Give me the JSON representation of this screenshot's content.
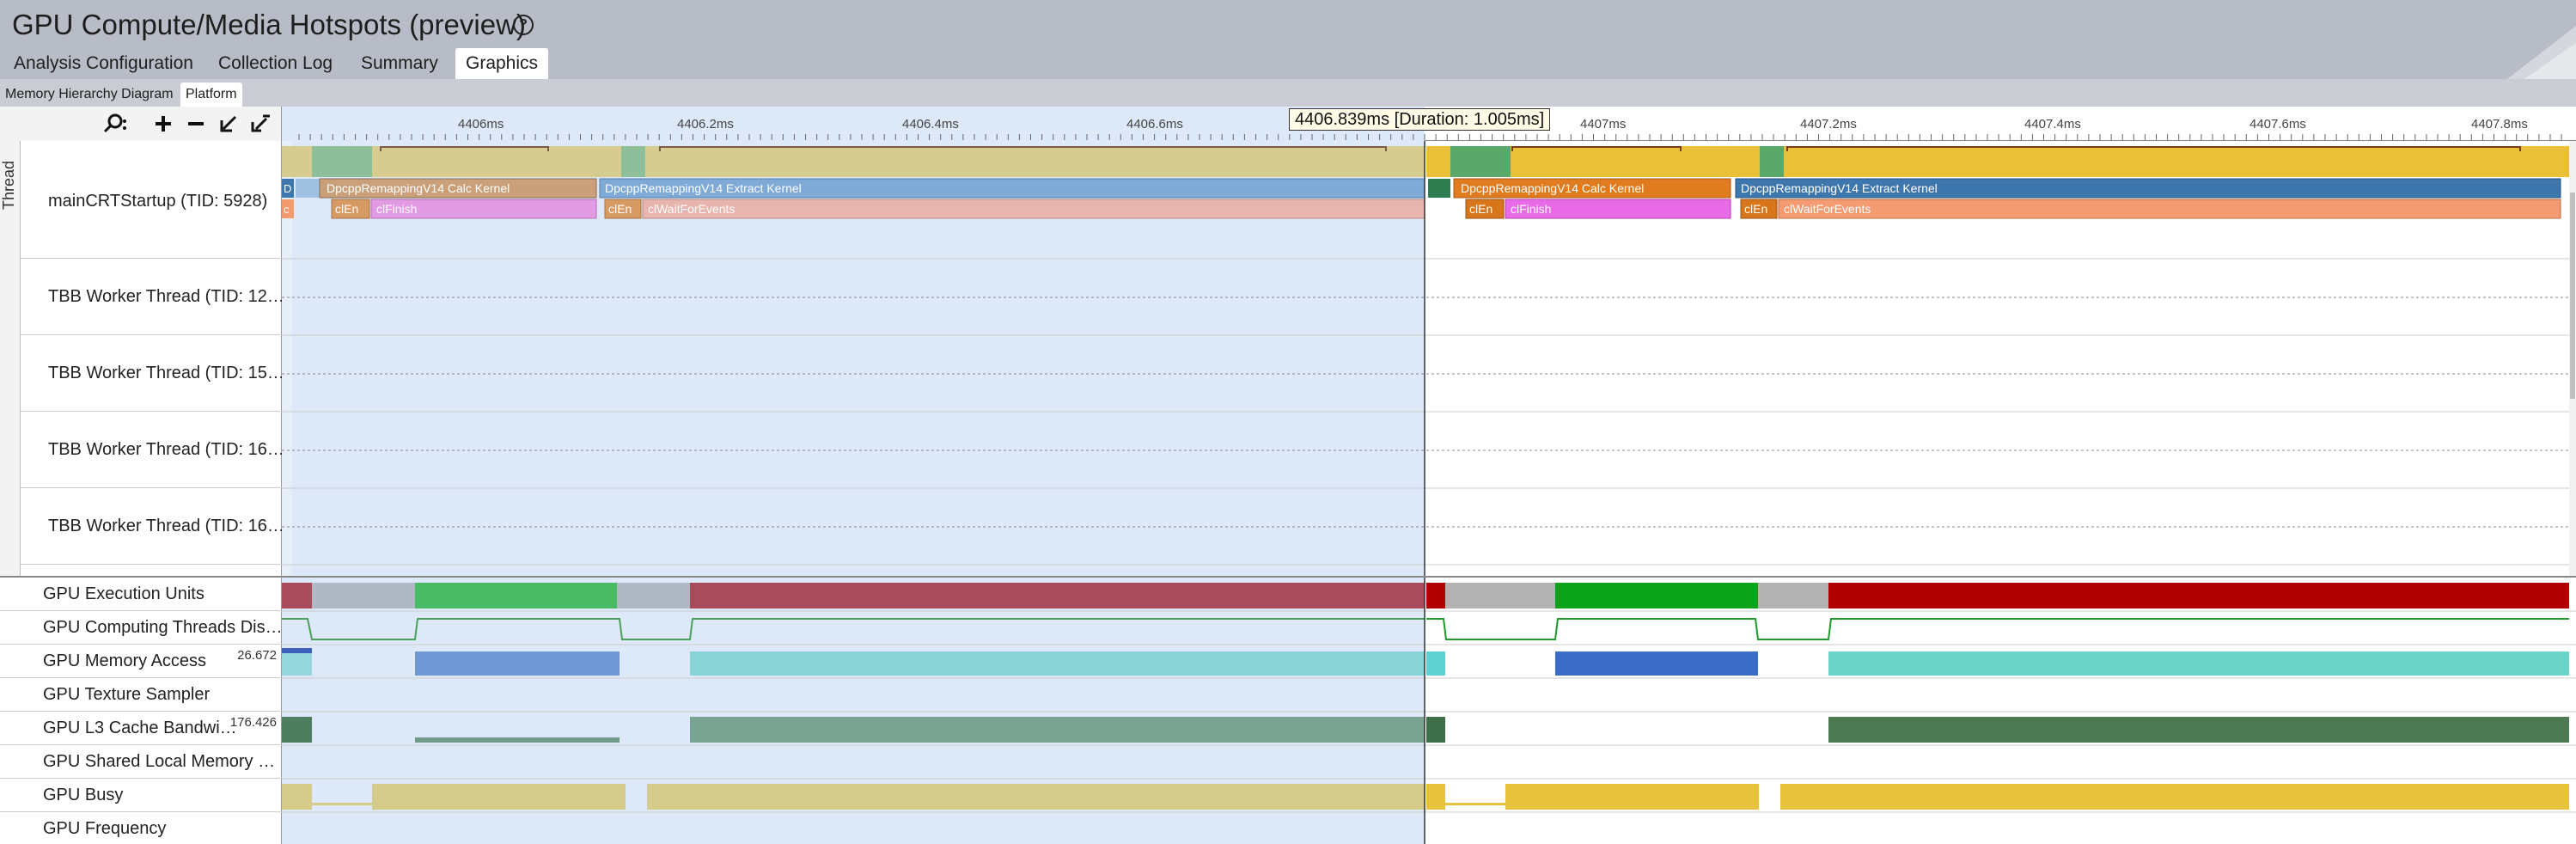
{
  "header": {
    "title": "GPU Compute/Media Hotspots (preview)",
    "tabs": [
      "Analysis Configuration",
      "Collection Log",
      "Summary",
      "Graphics"
    ],
    "active_tab": "Graphics"
  },
  "subtabs": {
    "items": [
      "Memory Hierarchy Diagram",
      "Platform"
    ],
    "active": "Platform"
  },
  "toolbar": {
    "icons": [
      "search-icon",
      "zoom-in-icon",
      "zoom-out-icon",
      "undo-zoom-icon",
      "reset-zoom-icon"
    ]
  },
  "ruler": {
    "ticks": [
      "4406ms",
      "4406.2ms",
      "4406.4ms",
      "4406.6ms",
      "4407ms",
      "4407.2ms",
      "4407.4ms",
      "4407.6ms",
      "4407.8ms"
    ],
    "tooltip": "4406.839ms [Duration: 1.005ms]"
  },
  "thread_axis_label": "Thread",
  "threads": [
    "mainCRTStartup (TID: 5928)",
    "TBB Worker Thread (TID: 12…",
    "TBB Worker Thread (TID: 15…",
    "TBB Worker Thread (TID: 16…",
    "TBB Worker Thread (TID: 16…"
  ],
  "tasks": {
    "first_slot": "D",
    "calc_kernel": "DpcppRemappingV14 Calc Kernel",
    "extract_kernel": "DpcppRemappingV14 Extract Kernel",
    "cl_en": "clEn",
    "cl_finish": "clFinish",
    "cl_wait": "clWaitForEvents",
    "stub": "c"
  },
  "gpu_metrics": [
    {
      "label": "GPU Execution Units",
      "value": ""
    },
    {
      "label": "GPU Computing Threads Dis…",
      "value": ""
    },
    {
      "label": "GPU Memory Access",
      "value": "26.672"
    },
    {
      "label": "GPU Texture Sampler",
      "value": ""
    },
    {
      "label": "GPU L3 Cache Bandwi…",
      "value": "176.426"
    },
    {
      "label": "GPU Shared Local Memory …",
      "value": ""
    },
    {
      "label": "GPU Busy",
      "value": ""
    },
    {
      "label": "GPU Frequency",
      "value": ""
    }
  ],
  "colors": {
    "selection": "#dde9f8",
    "calc_kernel": "#c9a07a",
    "calc_kernel_active": "#e07b1f",
    "extract_kernel": "#7fa9d6",
    "extract_kernel_active": "#3e77ad",
    "cl_finish": "#e29be3",
    "cl_finish_active": "#e86ae6",
    "cl_wait": "#e8b5ae",
    "cl_wait_active": "#f59b72",
    "eu_stall": "#a94b5b",
    "eu_stall_active": "#b00000",
    "eu_active": "#2fb34e",
    "eu_active_bright": "#0aa31a",
    "memory": "#6f97d3",
    "memory_teal": "#78cfd0",
    "l3": "#5e8f72",
    "gpu_busy": "#d5cb8a",
    "gpu_busy_active": "#e6c23d"
  }
}
